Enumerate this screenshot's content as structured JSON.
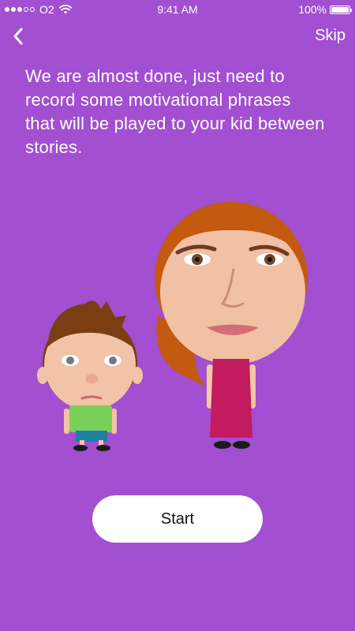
{
  "status_bar": {
    "carrier": "O2",
    "time": "9:41 AM",
    "battery": "100%",
    "battery_level": 1.0,
    "signal_bars_filled": 3,
    "signal_bars_total": 5
  },
  "nav": {
    "back_icon": "chevron-left-icon",
    "skip_label": "Skip"
  },
  "main": {
    "message": "We are almost done, just need to record some motivational phrases that will be played to your kid between stories."
  },
  "actions": {
    "start_label": "Start"
  },
  "colors": {
    "background": "#a24fd1",
    "button_bg": "#ffffff",
    "text": "#ffffff"
  }
}
